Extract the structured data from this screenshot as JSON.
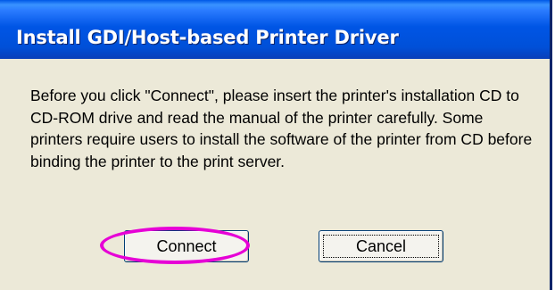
{
  "dialog": {
    "title": "Install GDI/Host-based Printer Driver",
    "message": "Before you click \"Connect\", please insert the printer's installation CD to CD-ROM drive and read the manual of the printer carefully. Some printers require users to install the software of the printer from CD before binding the printer to the print server."
  },
  "buttons": {
    "connect_label": "Connect",
    "cancel_label": "Cancel"
  },
  "colors": {
    "titlebar": "#0055e5",
    "dialog_bg": "#ece9d8",
    "highlight": "#e600d6"
  }
}
